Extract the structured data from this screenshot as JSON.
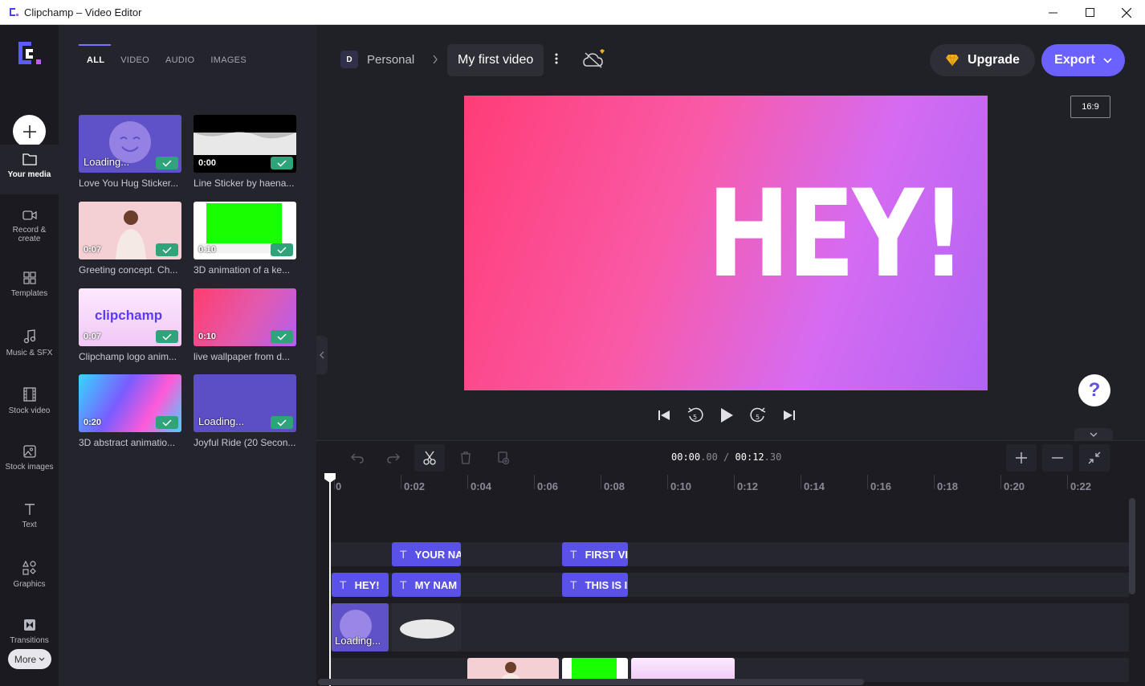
{
  "window": {
    "title": "Clipchamp – Video Editor"
  },
  "rail": {
    "items": [
      {
        "label": "Your media",
        "icon": "folder-icon"
      },
      {
        "label": "Record & create",
        "icon": "camera-icon"
      },
      {
        "label": "Templates",
        "icon": "templates-icon"
      },
      {
        "label": "Music & SFX",
        "icon": "music-icon"
      },
      {
        "label": "Stock video",
        "icon": "film-icon"
      },
      {
        "label": "Stock images",
        "icon": "image-icon"
      },
      {
        "label": "Text",
        "icon": "text-icon"
      },
      {
        "label": "Graphics",
        "icon": "shapes-icon"
      },
      {
        "label": "Transitions",
        "icon": "transitions-icon"
      }
    ],
    "more_label": "More"
  },
  "media": {
    "tabs": [
      "ALL",
      "VIDEO",
      "AUDIO",
      "IMAGES"
    ],
    "items": [
      {
        "name": "Love You Hug Sticker...",
        "overlay": "Loading..."
      },
      {
        "name": "Line Sticker by haena...",
        "overlay": "0:00"
      },
      {
        "name": "Greeting concept. Ch...",
        "overlay": "0:07"
      },
      {
        "name": "3D animation of a ke...",
        "overlay": "0:10"
      },
      {
        "name": "Clipchamp logo anim...",
        "overlay": "0:07",
        "thumb_text": "clipchamp"
      },
      {
        "name": "live wallpaper from d...",
        "overlay": "0:10"
      },
      {
        "name": "3D abstract animatio...",
        "overlay": "0:20"
      },
      {
        "name": "Joyful Ride (20 Secon...",
        "overlay": "Loading..."
      }
    ]
  },
  "header": {
    "workspace_initial": "D",
    "workspace_name": "Personal",
    "project_name": "My first video",
    "upgrade_label": "Upgrade",
    "export_label": "Export"
  },
  "preview": {
    "text": "HEY!",
    "aspect_ratio": "16:9",
    "help_symbol": "?"
  },
  "timeline": {
    "timecode_current_main": "00:00",
    "timecode_current_frac": ".00",
    "timecode_separator": "/",
    "timecode_total_main": "00:12",
    "timecode_total_frac": ".30",
    "ruler_labels": [
      "0",
      "0:02",
      "0:04",
      "0:06",
      "0:08",
      "0:10",
      "0:12",
      "0:14",
      "0:16",
      "0:18",
      "0:20",
      "0:22"
    ],
    "text_clips": [
      {
        "label": "YOUR NA"
      },
      {
        "label": "FIRST VI"
      },
      {
        "label": "HEY!"
      },
      {
        "label": "MY NAM"
      },
      {
        "label": "THIS IS I"
      }
    ],
    "video_clip_overlay": "Loading..."
  },
  "colors": {
    "accent": "#6b61ff",
    "text_clip": "#5a51e8",
    "check": "#2fa37a"
  }
}
